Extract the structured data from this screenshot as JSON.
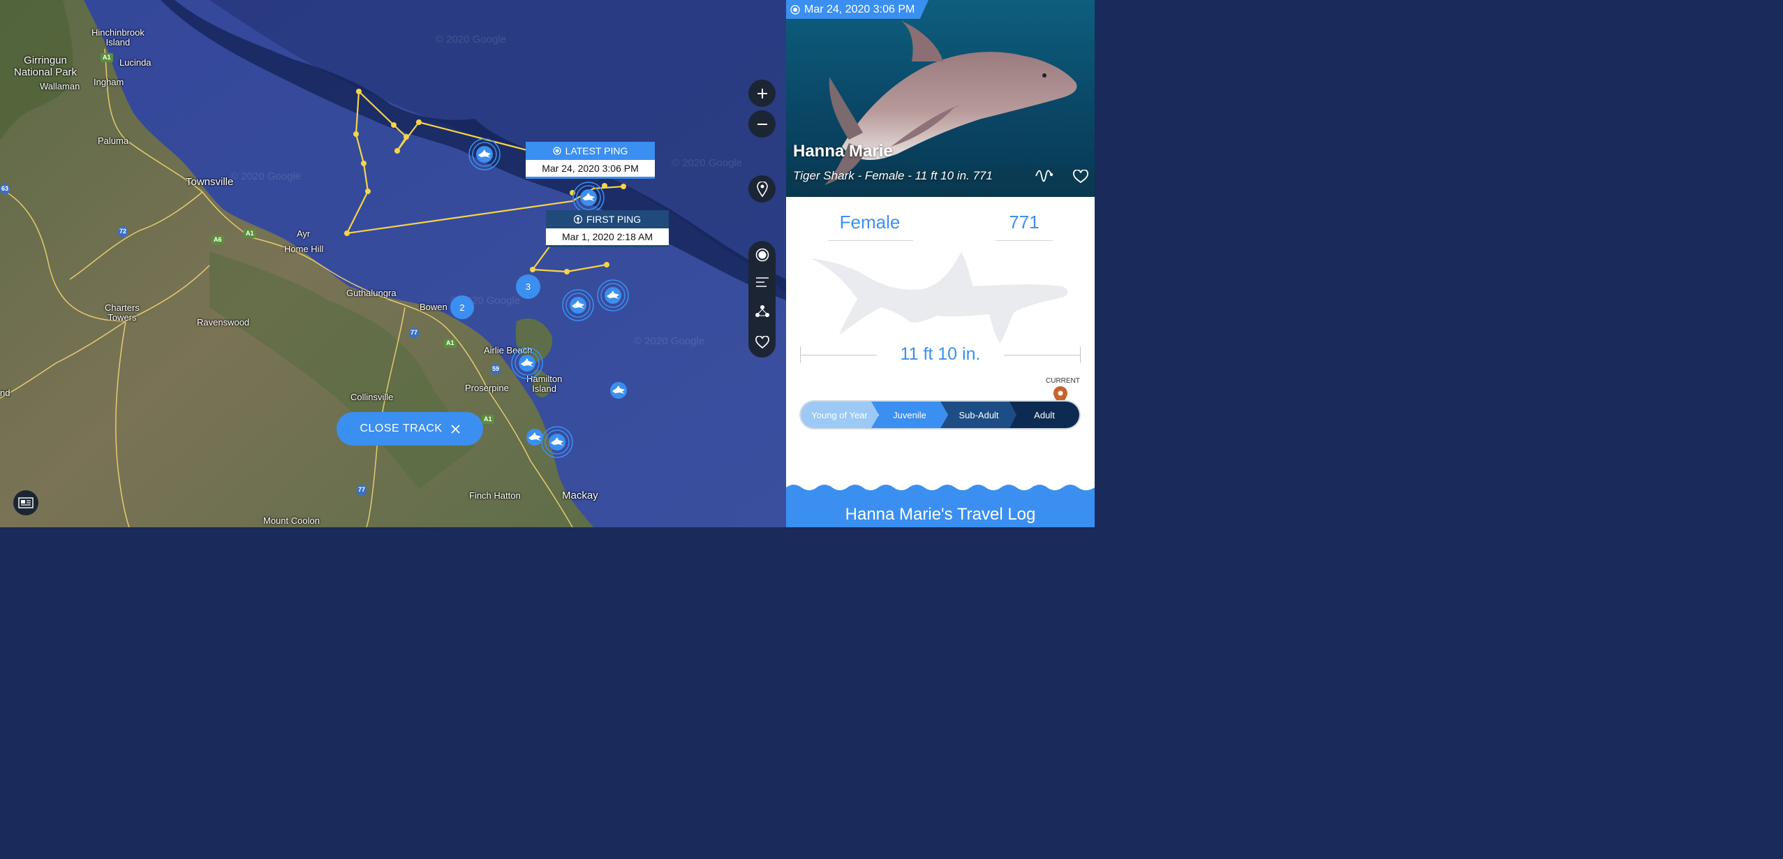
{
  "map": {
    "places": [
      {
        "id": "hinchinbrook",
        "text": "Hinchinbrook\nIsland"
      },
      {
        "id": "girringun",
        "text": "Girringun\nNational Park"
      },
      {
        "id": "lucinda",
        "text": "Lucinda"
      },
      {
        "id": "wallaman",
        "text": "Wallaman"
      },
      {
        "id": "ingham",
        "text": "Ingham"
      },
      {
        "id": "paluma",
        "text": "Paluma"
      },
      {
        "id": "townsville",
        "text": "Townsville"
      },
      {
        "id": "ayr",
        "text": "Ayr"
      },
      {
        "id": "homehill",
        "text": "Home Hill"
      },
      {
        "id": "guthalungra",
        "text": "Guthalungra"
      },
      {
        "id": "bowen",
        "text": "Bowen"
      },
      {
        "id": "charters",
        "text": "Charters\nTowers"
      },
      {
        "id": "ravenswood",
        "text": "Ravenswood"
      },
      {
        "id": "airlie",
        "text": "Airlie Beach"
      },
      {
        "id": "hamilton",
        "text": "Hamilton\nIsland"
      },
      {
        "id": "proserpine",
        "text": "Proserpine"
      },
      {
        "id": "collinsville",
        "text": "Collinsville"
      },
      {
        "id": "finchhatton",
        "text": "Finch Hatton"
      },
      {
        "id": "mackay",
        "text": "Mackay"
      },
      {
        "id": "mountcoolon",
        "text": "Mount Coolon"
      },
      {
        "id": "nd",
        "text": "nd"
      }
    ],
    "shields": [
      "A1",
      "A1",
      "A6",
      "72",
      "A1",
      "77",
      "A1",
      "59",
      "A1",
      "77",
      "63"
    ],
    "watermark": "© 2020 Google",
    "latest_ping": {
      "label": "LATEST PING",
      "date": "Mar 24, 2020 3:06 PM"
    },
    "first_ping": {
      "label": "FIRST PING",
      "date": "Mar 1, 2020 2:18 AM"
    },
    "clusters": [
      "3",
      "2"
    ],
    "close_track": "CLOSE TRACK",
    "colors": {
      "track": "#f5d547",
      "accent": "#3b8ff0",
      "ocean": "#2b3f8a",
      "land": "#6b6a4a"
    }
  },
  "controls": [
    "zoom-in",
    "zoom-out",
    "location-pin",
    "sharks-icon",
    "list-icon",
    "cluster-icon",
    "heart-icon"
  ],
  "panel": {
    "header_date": "Mar 24, 2020 3:06 PM",
    "name": "Hanna Marie",
    "subtitle": "Tiger Shark - Female - 11 ft 10 in. 771",
    "gender": "Female",
    "tag_number": "771",
    "length": "11 ft 10 in.",
    "current_label": "CURRENT",
    "stages": [
      "Young of Year",
      "Juvenile",
      "Sub-Adult",
      "Adult"
    ],
    "current_stage": "Adult",
    "travel_log_title": "Hanna Marie's Travel Log"
  }
}
